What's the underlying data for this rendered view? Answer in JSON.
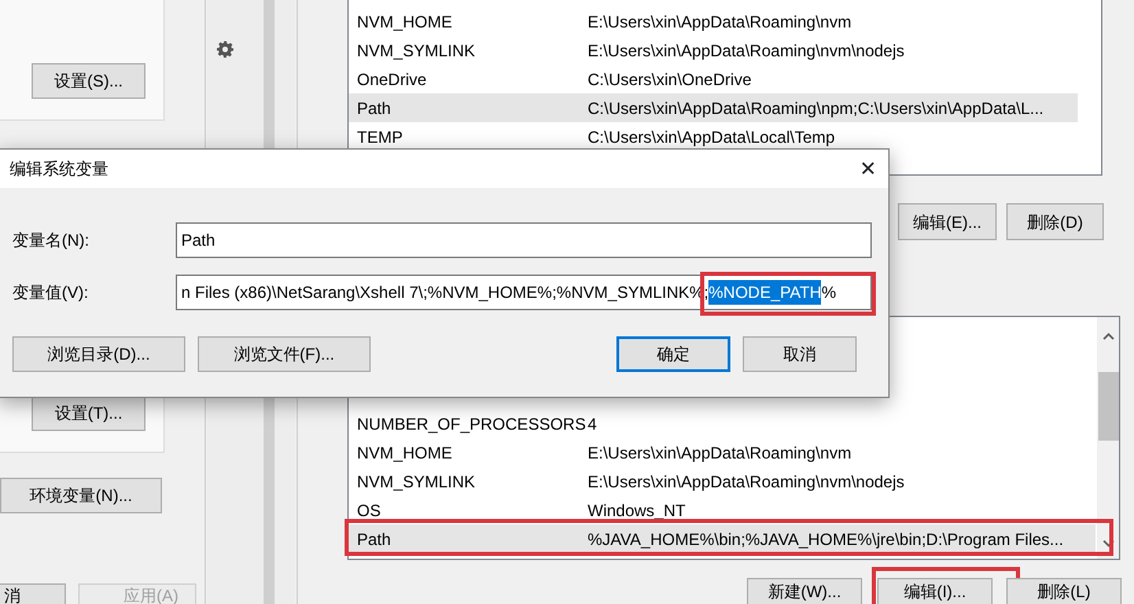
{
  "system_properties": {
    "buttons": [
      {
        "label": "设置(S)..."
      },
      {
        "label": "设置(T)..."
      },
      {
        "label": "环境变量(N)..."
      }
    ],
    "footer_buttons": [
      {
        "label": "消",
        "disabled": false
      },
      {
        "label": "应用(A)",
        "disabled": true
      }
    ]
  },
  "environment_variables": {
    "user_variables": [
      {
        "name": "NVM_HOME",
        "value": "E:\\Users\\xin\\AppData\\Roaming\\nvm",
        "selected": false
      },
      {
        "name": "NVM_SYMLINK",
        "value": "E:\\Users\\xin\\AppData\\Roaming\\nvm\\nodejs",
        "selected": false
      },
      {
        "name": "OneDrive",
        "value": "C:\\Users\\xin\\OneDrive",
        "selected": false
      },
      {
        "name": "Path",
        "value": "C:\\Users\\xin\\AppData\\Roaming\\npm;C:\\Users\\xin\\AppData\\L...",
        "selected": true
      },
      {
        "name": "TEMP",
        "value": "C:\\Users\\xin\\AppData\\Local\\Temp",
        "selected": false
      }
    ],
    "user_buttons": [
      {
        "label": "编辑(E)..."
      },
      {
        "label": "删除(D)"
      }
    ],
    "system_variables": [
      {
        "name": "NUMBER_OF_PROCESSORS",
        "value": "4",
        "selected": false,
        "annotated": false
      },
      {
        "name": "NVM_HOME",
        "value": "E:\\Users\\xin\\AppData\\Roaming\\nvm",
        "selected": false,
        "annotated": false
      },
      {
        "name": "NVM_SYMLINK",
        "value": "E:\\Users\\xin\\AppData\\Roaming\\nvm\\nodejs",
        "selected": false,
        "annotated": false
      },
      {
        "name": "OS",
        "value": "Windows_NT",
        "selected": false,
        "annotated": false
      },
      {
        "name": "Path",
        "value": "%JAVA_HOME%\\bin;%JAVA_HOME%\\jre\\bin;D:\\Program Files...",
        "selected": true,
        "annotated": true
      }
    ],
    "system_buttons": [
      {
        "label": "新建(W)...",
        "annotated": false
      },
      {
        "label": "编辑(I)...",
        "annotated": true
      },
      {
        "label": "删除(L)",
        "annotated": false
      }
    ]
  },
  "dialog": {
    "title": "编辑系统变量",
    "close": "✕",
    "name_field": {
      "label": "变量名(N):",
      "value": "Path"
    },
    "value_field": {
      "label": "变量值(V):",
      "value_before": "n Files (x86)\\NetSarang\\Xshell 7\\;%NVM_HOME%;%NVM_SYMLINK%;",
      "selection": "%NODE_PATH",
      "value_after": "%",
      "annotated": true
    },
    "buttons": [
      {
        "label": "浏览目录(D)...",
        "default": false
      },
      {
        "label": "浏览文件(F)...",
        "default": false
      },
      {
        "label": "确定",
        "default": true
      },
      {
        "label": "取消",
        "default": false
      }
    ]
  }
}
